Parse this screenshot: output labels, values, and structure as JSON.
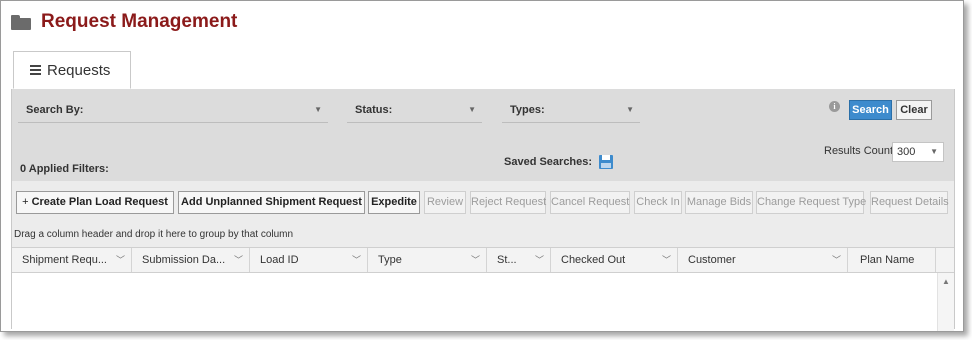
{
  "page": {
    "title": "Request Management"
  },
  "icons": {
    "header": "folder-icon",
    "tab": "menu-icon",
    "info": "info-icon",
    "saved": "save-disk-icon"
  },
  "colors": {
    "title": "#8b1a1a",
    "search_button": "#3d8bcd",
    "search_bar": "#dcdcdc"
  },
  "tabs": [
    {
      "label": "Requests",
      "active": true
    }
  ],
  "search": {
    "search_by_label": "Search By:",
    "status_label": "Status:",
    "types_label": "Types:",
    "search_button": "Search",
    "clear_button": "Clear",
    "applied_filters": "0 Applied Filters:",
    "saved_searches": "Saved Searches:",
    "results_count_label": "Results Count:",
    "results_count_value": "300"
  },
  "toolbar": {
    "create_plan": "Create Plan Load Request",
    "add_unplanned": "Add Unplanned Shipment Request",
    "expedite": "Expedite",
    "review": "Review",
    "reject": "Reject Request",
    "cancel": "Cancel Request",
    "check_in": "Check In",
    "manage_bids": "Manage Bids",
    "change_type": "Change Request Type",
    "details": "Request Details"
  },
  "grid": {
    "group_hint": "Drag a column header and drop it here to group by that column",
    "columns": [
      "Shipment Requ...",
      "Submission Da...",
      "Load ID",
      "Type",
      "St...",
      "Checked Out",
      "Customer",
      "Plan Name"
    ]
  }
}
